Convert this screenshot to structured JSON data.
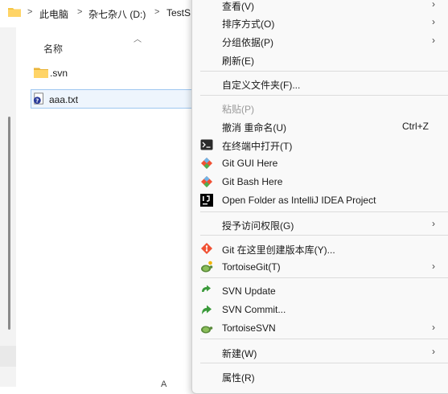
{
  "explorer": {
    "breadcrumb": [
      "此电脑",
      "杂七杂八 (D:)",
      "TestS"
    ],
    "column_header": "名称",
    "files": [
      {
        "name": ".svn",
        "type": "folder"
      },
      {
        "name": "aaa.txt",
        "type": "svn-file"
      }
    ],
    "bottom_fragment": "A"
  },
  "menu": {
    "items": {
      "view": "查看(V)",
      "sort": "排序方式(O)",
      "group": "分组依据(P)",
      "refresh": "刷新(E)",
      "customize": "自定义文件夹(F)...",
      "paste": "粘贴(P)",
      "undo_rename": "撤消 重命名(U)",
      "undo_shortcut": "Ctrl+Z",
      "open_terminal": "在终端中打开(T)",
      "git_gui": "Git GUI Here",
      "git_bash": "Git Bash Here",
      "open_idea": "Open Folder as IntelliJ IDEA Project",
      "grant_access": "授予访问权限(G)",
      "git_create_repo": "Git 在这里创建版本库(Y)...",
      "tortoisegit": "TortoiseGit(T)",
      "svn_update": "SVN Update",
      "svn_commit": "SVN Commit...",
      "tortoisesvn": "TortoiseSVN",
      "new": "新建(W)",
      "properties": "属性(R)"
    },
    "submenu_arrow": "›"
  },
  "colors": {
    "menu_bg": "#f9f9f9",
    "selection_border": "#9ec7f0",
    "folder_yellow": "#f5c542",
    "svn_green": "#3a9a3a",
    "git_orange": "#f05133"
  }
}
